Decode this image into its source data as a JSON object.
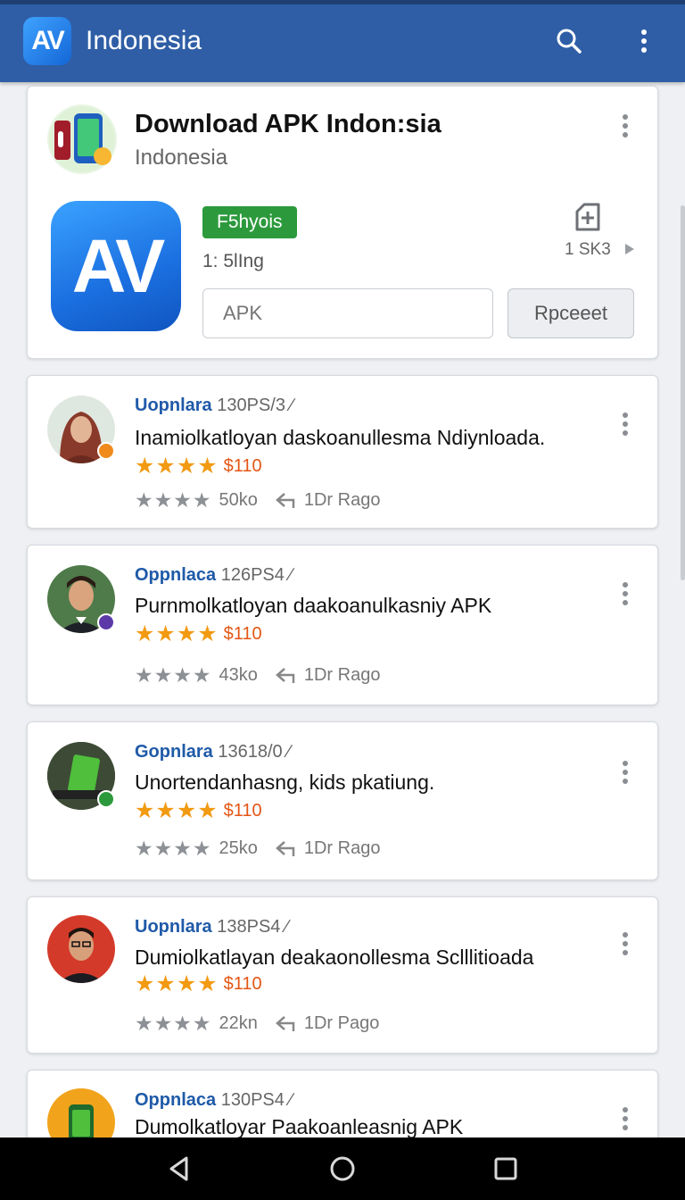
{
  "app_bar": {
    "logo_text": "AV",
    "title": "Indonesia",
    "background": "#2f5ea6",
    "icons": [
      "search-icon",
      "more-vert-icon"
    ]
  },
  "app_header": {
    "title": "Download APK Indon:sia",
    "subtitle": "Indonesia",
    "logo_text": "AV",
    "badge": "F5hyois",
    "badge_color": "#2c9a3c",
    "size": "1: 5lIng",
    "download_count": "1 SK3",
    "input_placeholder": "APK",
    "report_button": "Rpceeet"
  },
  "reviews": [
    {
      "user": "Uopnlara",
      "code": "130PS/3",
      "text": "Inamiolkatloyan daskoanullesma Ndiynloada.",
      "price": "$110",
      "count": "50ko",
      "time": "1Dr Rago",
      "avatar_color": "#8a3a2a"
    },
    {
      "user": "Oppnlaca",
      "code": "126PS4",
      "text": "Purnmolkatloyan daakoanulkasniy APK",
      "price": "$110",
      "count": "43ko",
      "time": "1Dr Rago",
      "avatar_color": "#3b4a3a"
    },
    {
      "user": "Gopnlara",
      "code": "13618/0",
      "text": "Unortendanhasng, kids pkatiung.",
      "price": "$110",
      "count": "25ko",
      "time": "1Dr Rago",
      "avatar_color": "#2f3a2c"
    },
    {
      "user": "Uopnlara",
      "code": "138PS4",
      "text": "Dumiolkatlayan deakaonollesma Sclllitioada",
      "price": "$110",
      "count": "22kn",
      "time": "1Dr Pago",
      "avatar_color": "#d43a2a"
    },
    {
      "user": "Oppnlaca",
      "code": "130PS4",
      "text": "Dumolkatloyar Paakoanleasnig APK",
      "price": "",
      "count": "",
      "time": "",
      "avatar_color": "#f2a31c"
    }
  ],
  "nav_bar": {
    "icons": [
      "back-icon",
      "home-icon",
      "recents-icon"
    ]
  }
}
